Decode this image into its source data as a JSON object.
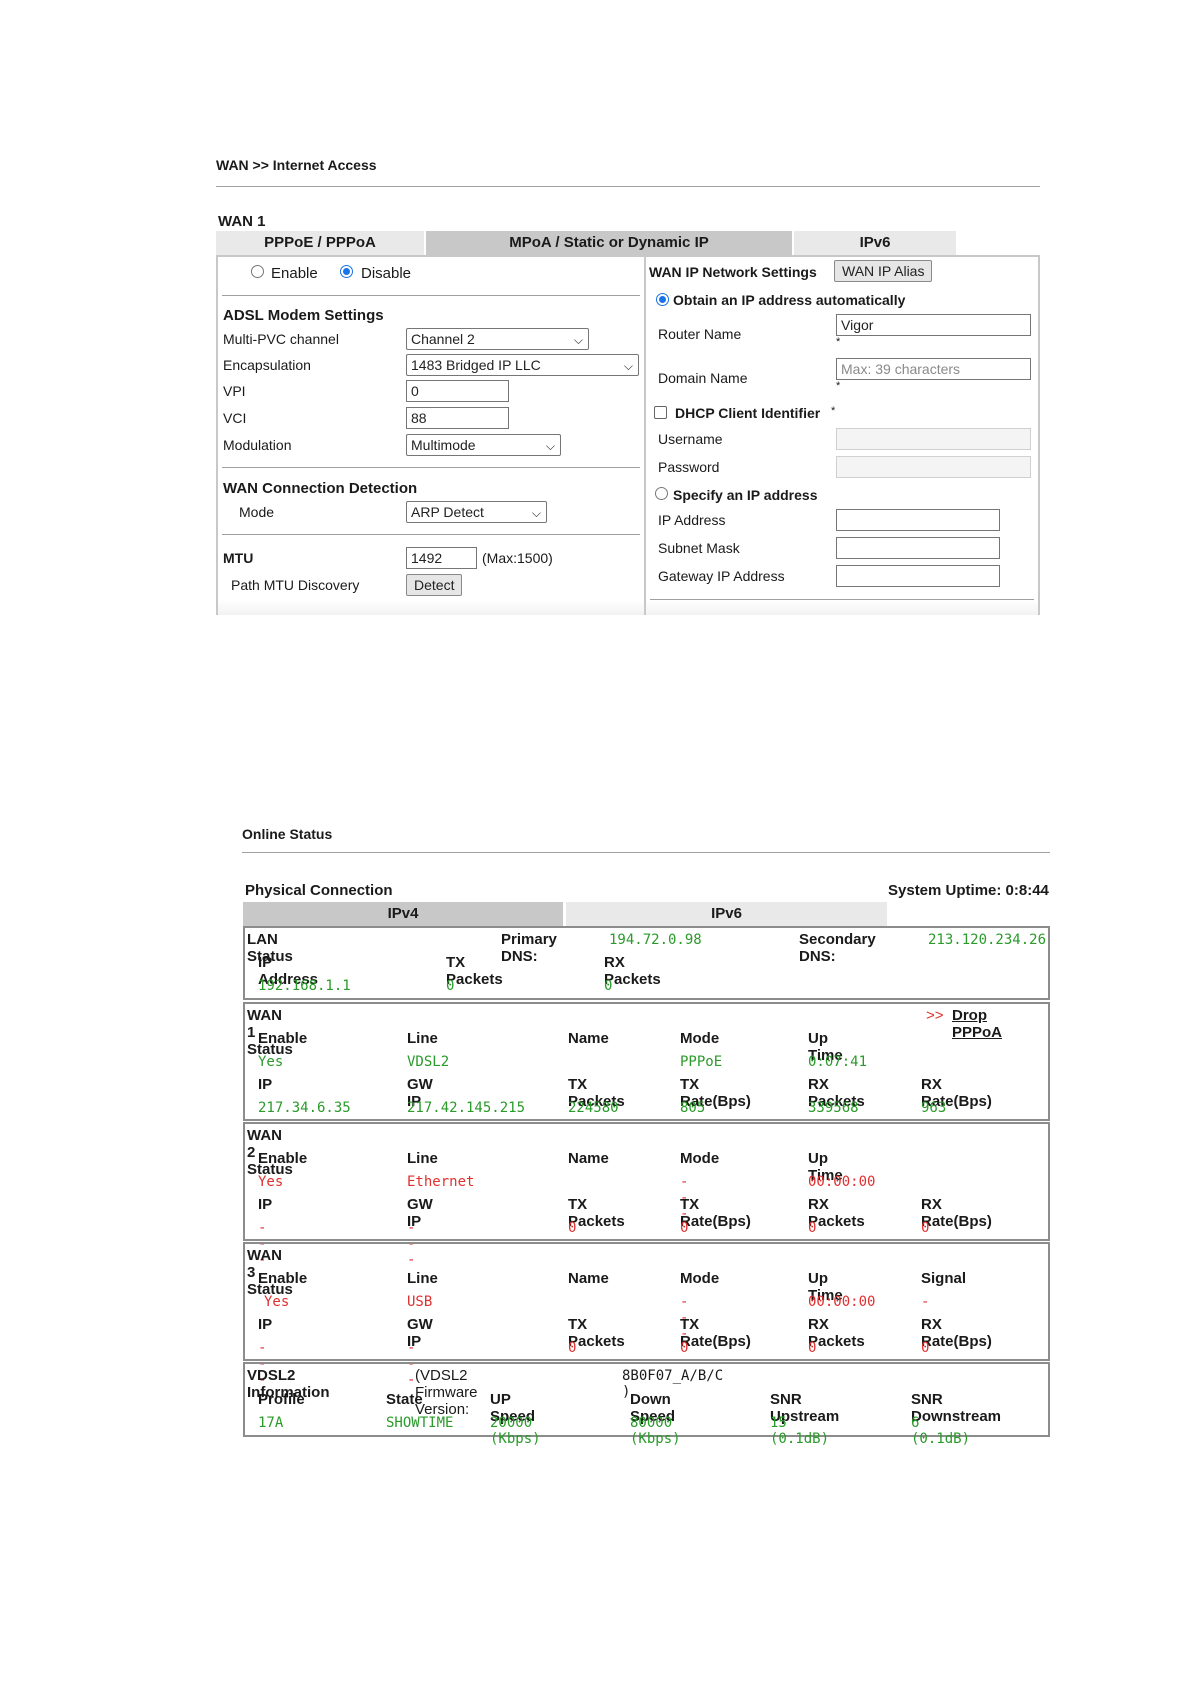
{
  "page1": {
    "breadcrumb": "WAN >> Internet Access",
    "wan_title": "WAN 1",
    "tabs": [
      "PPPoE / PPPoA",
      "MPoA / Static or Dynamic IP",
      "IPv6"
    ],
    "enable_label": "Enable",
    "disable_label": "Disable",
    "adsl_title": "ADSL Modem Settings",
    "multipvc_label": "Multi-PVC channel",
    "multipvc_value": "Channel 2",
    "encap_label": "Encapsulation",
    "encap_value": "1483 Bridged IP LLC",
    "vpi_label": "VPI",
    "vpi_value": "0",
    "vci_label": "VCI",
    "vci_value": "88",
    "modulation_label": "Modulation",
    "modulation_value": "Multimode",
    "detection_title": "WAN Connection Detection",
    "mode_label": "Mode",
    "mode_value": "ARP Detect",
    "mtu_label": "MTU",
    "mtu_value": "1492",
    "mtu_max": "(Max:1500)",
    "pmtu_label": "Path MTU Discovery",
    "detect_button": "Detect",
    "wanip_title": "WAN IP Network Settings",
    "alias_button": "WAN IP Alias",
    "obtain_label": "Obtain an IP address automatically",
    "router_name_label": "Router Name",
    "router_name_value": "Vigor",
    "domain_label": "Domain Name",
    "domain_placeholder": "Max: 39 characters",
    "asterisk": "*",
    "dhcp_label": "DHCP Client Identifier",
    "username_label": "Username",
    "password_label": "Password",
    "specify_label": "Specify an IP address",
    "ip_label": "IP Address",
    "mask_label": "Subnet Mask",
    "gateway_label": "Gateway IP Address"
  },
  "page2": {
    "title": "Online Status",
    "physical_label": "Physical Connection",
    "uptime": "System Uptime: 0:8:44",
    "tabs": [
      "IPv4",
      "IPv6"
    ],
    "lan": {
      "title": "LAN Status",
      "primary_dns_label": "Primary DNS:",
      "primary_dns": "194.72.0.98",
      "secondary_dns_label": "Secondary DNS:",
      "secondary_dns": "213.120.234.26",
      "headers": [
        "IP Address",
        "TX Packets",
        "RX Packets"
      ],
      "values": [
        "192.168.1.1",
        "0",
        "0"
      ]
    },
    "wan1": {
      "title": "WAN 1 Status",
      "drop_prefix": ">>",
      "drop_link": "Drop PPPoA",
      "headers1": [
        "Enable",
        "Line",
        "Name",
        "Mode",
        "Up Time"
      ],
      "values1": [
        "Yes",
        "VDSL2",
        "",
        "PPPoE",
        "0:07:41"
      ],
      "headers2": [
        "IP",
        "GW IP",
        "TX Packets",
        "TX Rate(Bps)",
        "RX Packets",
        "RX Rate(Bps)"
      ],
      "values2": [
        "217.34.6.35",
        "217.42.145.215",
        "224580",
        "805",
        "339568",
        "963"
      ]
    },
    "wan2": {
      "title": "WAN 2 Status",
      "headers1": [
        "Enable",
        "Line",
        "Name",
        "Mode",
        "Up Time"
      ],
      "values1": [
        "Yes",
        "Ethernet",
        "",
        "---",
        "00:00:00"
      ],
      "headers2": [
        "IP",
        "GW IP",
        "TX Packets",
        "TX Rate(Bps)",
        "RX Packets",
        "RX Rate(Bps)"
      ],
      "values2": [
        "---",
        "---",
        "0",
        "0",
        "0",
        "0"
      ]
    },
    "wan3": {
      "title": "WAN 3 Status",
      "headers1": [
        "Enable",
        "Line",
        "Name",
        "Mode",
        "Up Time",
        "Signal"
      ],
      "values1": [
        "Yes",
        "USB",
        "",
        "---",
        "00:00:00",
        "-"
      ],
      "headers2": [
        "IP",
        "GW IP",
        "TX Packets",
        "TX Rate(Bps)",
        "RX Packets",
        "RX Rate(Bps)"
      ],
      "values2": [
        "---",
        "---",
        "0",
        "0",
        "0",
        "0"
      ]
    },
    "vdsl": {
      "title": "VDSL2 Information",
      "firmware_label": "(VDSL2 Firmware Version:",
      "firmware_value": "8B0F07_A/B/C )",
      "headers": [
        "Profile",
        "State",
        "UP Speed",
        "Down Speed",
        "SNR Upstream",
        "SNR Downstream"
      ],
      "values": [
        "17A",
        "SHOWTIME",
        "20000 (Kbps)",
        "80000 (Kbps)",
        "15 (0.1dB)",
        "6 (0.1dB)"
      ]
    }
  }
}
